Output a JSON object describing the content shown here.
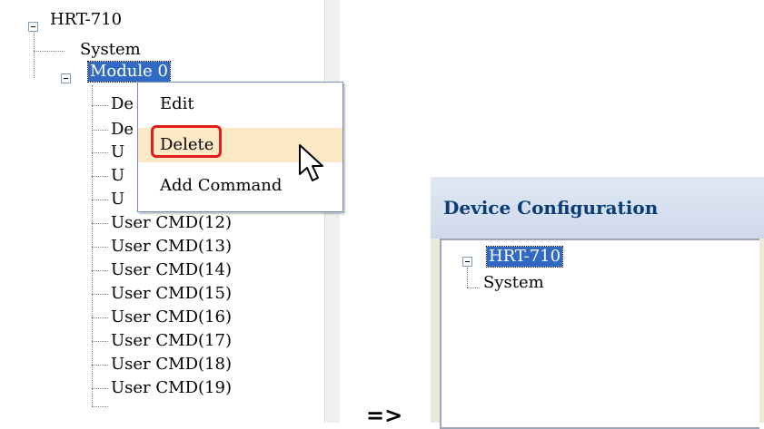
{
  "left_tree": {
    "root": "HRT-710",
    "system": "System",
    "module": "Module 0",
    "hidden_rows": [
      "De",
      "De",
      "U",
      "U",
      "U"
    ],
    "user_cmds": [
      "User CMD(12)",
      "User CMD(13)",
      "User CMD(14)",
      "User CMD(15)",
      "User CMD(16)",
      "User CMD(17)",
      "User CMD(18)",
      "User CMD(19)"
    ]
  },
  "context_menu": {
    "items": [
      {
        "label": "Edit"
      },
      {
        "label": "Delete"
      },
      {
        "label": "Add Command"
      }
    ],
    "highlight_color": "#e11c1c"
  },
  "arrow_text": "=>",
  "device_window": {
    "title": "Device Configuration",
    "tree": {
      "root": "HRT-710",
      "child": "System"
    }
  },
  "colors": {
    "selection": "#316ac5",
    "menu_hover": "#fde9c5",
    "title_text": "#0b3c7a"
  }
}
